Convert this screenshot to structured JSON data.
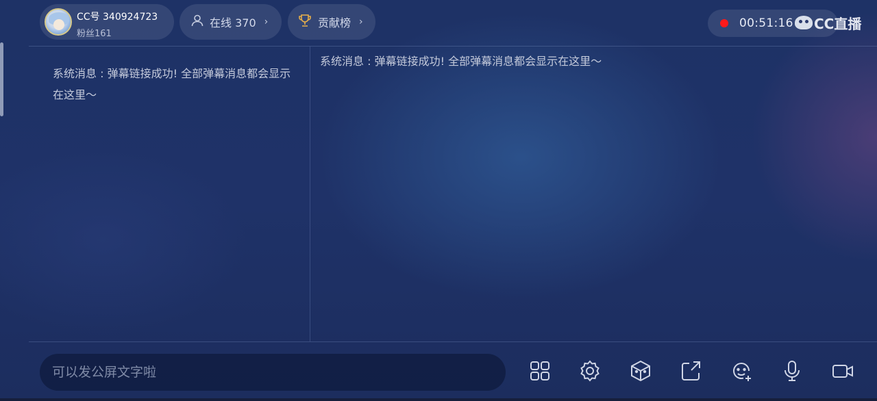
{
  "header": {
    "cc_id": "CC号 340924723",
    "fans": "粉丝161",
    "online_label": "在线 370",
    "contribution_label": "贡献榜",
    "record_time": "00:51:16",
    "watermark": "CC直播"
  },
  "messages": {
    "left": "系统消息 : 弹幕链接成功! 全部弹幕消息都会显示在这里～",
    "right": "系统消息 : 弹幕链接成功! 全部弹幕消息都会显示在这里～"
  },
  "chat": {
    "placeholder": "可以发公屏文字啦"
  },
  "toolbar": [
    {
      "icon": "grid-icon"
    },
    {
      "icon": "settings-icon"
    },
    {
      "icon": "box-icon"
    },
    {
      "icon": "share-icon"
    },
    {
      "icon": "face-add-icon"
    },
    {
      "icon": "microphone-icon"
    },
    {
      "icon": "video-camera-icon"
    }
  ],
  "colors": {
    "record_dot": "#ff1a1a",
    "trophy": "#e8b04a",
    "background": "#1f3268"
  }
}
